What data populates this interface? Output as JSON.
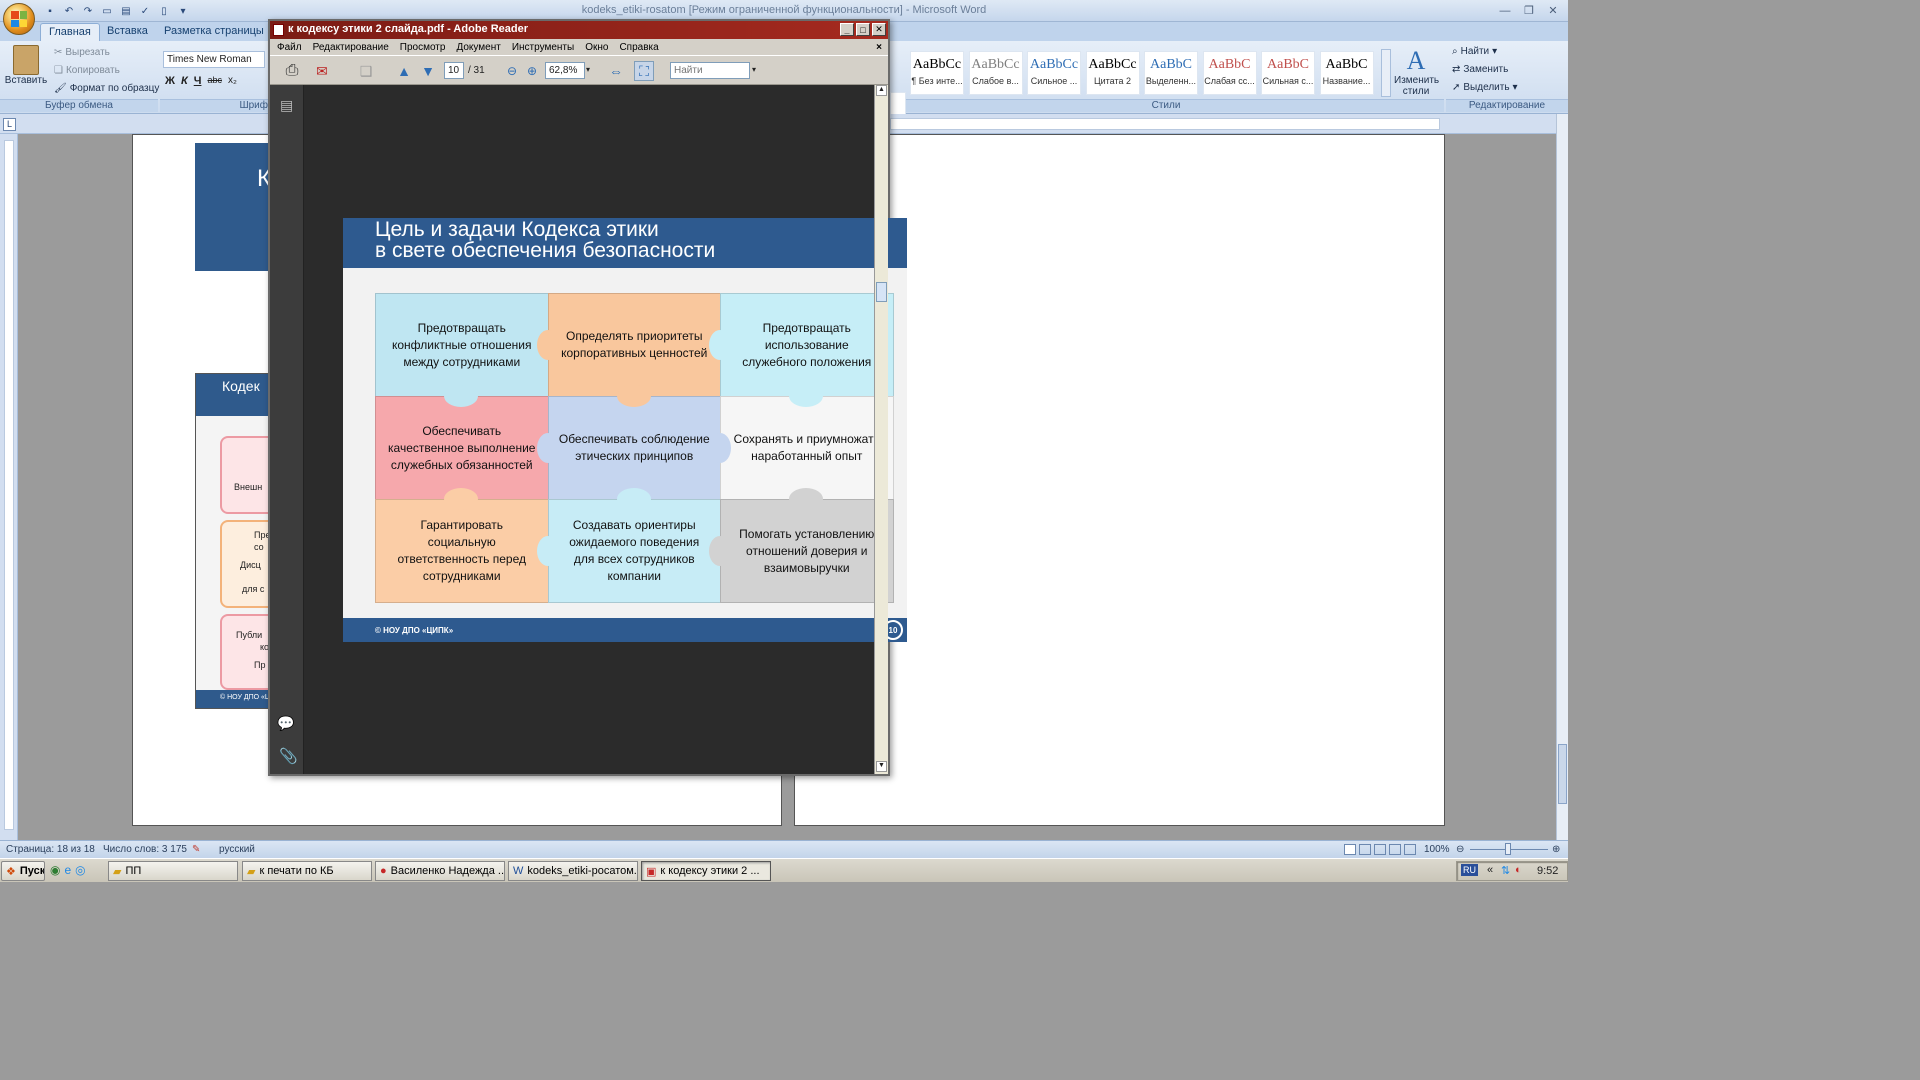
{
  "word": {
    "title": "kodeks_etiki-rosatom [Режим ограниченной функциональности] - Microsoft Word",
    "tabs": [
      "Главная",
      "Вставка",
      "Разметка страницы"
    ],
    "clipboard": {
      "paste": "Вставить",
      "cut": "Вырезать",
      "copy": "Копировать",
      "format_painter": "Формат по образцу",
      "group": "Буфер обмена"
    },
    "font": {
      "name": "Times New Roman",
      "group_partial": "Шриф"
    },
    "styles": {
      "group": "Стили",
      "items": [
        {
          "sample": "AaBbCc",
          "name": "¶ Без инте...",
          "color": "#000000"
        },
        {
          "sample": "AaBbCc",
          "name": "Слабое в...",
          "color": "#7f7f7f"
        },
        {
          "sample": "AaBbCc",
          "name": "Сильное ...",
          "color": "#2e6db4"
        },
        {
          "sample": "AaBbCc",
          "name": "Цитата 2",
          "color": "#000000"
        },
        {
          "sample": "AaBbC",
          "name": "Выделенн...",
          "color": "#2e6db4"
        },
        {
          "sample": "AaBbC",
          "name": "Слабая сс...",
          "color": "#c0504d"
        },
        {
          "sample": "AaBbC",
          "name": "Сильная с...",
          "color": "#c0504d"
        },
        {
          "sample": "AaBbC",
          "name": "Название...",
          "color": "#000000"
        }
      ],
      "change": "Изменить стили"
    },
    "editing": {
      "find": "Найти",
      "replace": "Заменить",
      "select": "Выделить",
      "group": "Редактирование"
    },
    "left_slide": {
      "title_partial": "К",
      "header_partial": "Кодек",
      "rows_partial": [
        "Внешн",
        "Пре",
        "со",
        "Дисц",
        "для с",
        "Публи",
        "ко",
        "Пр"
      ],
      "footer_partial": "© НОУ ДПО «Ц"
    },
    "status": {
      "page": "Страница: 18 из 18",
      "words": "Число слов: 3 175",
      "lang": "русский",
      "zoom": "100%"
    }
  },
  "reader": {
    "title": "к кодексу этики 2 слайда.pdf - Adobe Reader",
    "menu": [
      "Файл",
      "Редактирование",
      "Просмотр",
      "Документ",
      "Инструменты",
      "Окно",
      "Справка"
    ],
    "page_current": "10",
    "page_total": "/ 31",
    "zoom": "62,8%",
    "find_placeholder": "Найти",
    "slide": {
      "title_line1": "Цель и задачи Кодекса этики",
      "title_line2": "в свете обеспечения безопасности",
      "pieces": [
        {
          "text": "Предотвращать конфликтные отношения между сотрудниками",
          "color": "#bfe6f2"
        },
        {
          "text": "Определять приоритеты корпоративных ценностей",
          "color": "#f9c79d"
        },
        {
          "text": "Предотвращать использование служебного положения",
          "color": "#c6eef7"
        },
        {
          "text": "Обеспечивать качественное выполнение служебных обязанностей",
          "color": "#f6a8ac"
        },
        {
          "text": "Обеспечивать соблюдение этических принципов",
          "color": "#c5d5ef"
        },
        {
          "text": "Сохранять и приумножать наработанный опыт",
          "color": "#f6f6f6"
        },
        {
          "text": "Гарантировать социальную ответственность перед сотрудниками",
          "color": "#fbcda6"
        },
        {
          "text": "Создавать ориентиры ожидаемого поведения для всех сотрудников компании",
          "color": "#c7ecf6"
        },
        {
          "text": "Помогать установлению отношений доверия и взаимовыручки",
          "color": "#d2d2d2"
        }
      ],
      "footer": "© НОУ ДПО «ЦИПК»",
      "page_number": "10"
    }
  },
  "taskbar": {
    "start": "Пуск",
    "items": [
      {
        "label": "ПП",
        "active": false
      },
      {
        "label": "к печати по КБ",
        "active": false
      },
      {
        "label": "Василенко Надежда ...",
        "active": false
      },
      {
        "label": "kodeks_etiki-росатом...",
        "active": false
      },
      {
        "label": "к кодексу этики 2 ...",
        "active": true
      }
    ],
    "lang": "RU",
    "clock": "9:52"
  }
}
